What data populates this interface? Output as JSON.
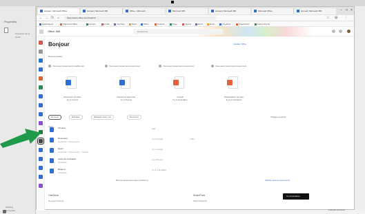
{
  "left_pane": {
    "title": "Properties",
    "sub_line1": "Propriétés de la",
    "sub_line2": "feuille",
    "bottom_line1": "Working",
    "bottom_line2": "connected"
  },
  "browser": {
    "tabs": [
      {
        "label": "Accueil - Microsoft Office"
      },
      {
        "label": "Accueil | Microsoft 365"
      },
      {
        "label": "Office - Microsoft"
      },
      {
        "label": "Microsoft 365"
      },
      {
        "label": "Accueil | Microsoft 365"
      },
      {
        "label": "Microsoft Office"
      },
      {
        "label": "Accueil | Microsoft 365"
      }
    ],
    "url": "https://www.office.com/?auth=2",
    "bookmarks": [
      "Applications",
      "Microsoft Office",
      "Accueil",
      "Gmail",
      "YouTube",
      "Maps",
      "Office",
      "Outlook",
      "Drive",
      "Teams",
      "Word",
      "Excel",
      "OneDrive",
      "PowerPoint",
      "Autres favoris"
    ]
  },
  "office_header": {
    "app_name": "Office 365",
    "search_placeholder": "Rechercher"
  },
  "rail": {
    "selected_label": "Word",
    "colors": [
      "#d9534f",
      "#999999",
      "#2f6fd1",
      "#2f6fd1",
      "#e0622d",
      "#2e8b57",
      "#2f6fd1",
      "#2f6fd1",
      "#2f6fd1",
      "#8a4fd1",
      "#1f7a3f",
      "#444444",
      "#2f6fd1",
      "#2f6fd1",
      "#2f6fd1",
      "#2f6fd1",
      "#8a4fd1"
    ]
  },
  "main": {
    "greeting": "Bonjour",
    "install_link": "Installer Office",
    "recommended_label": "Recommandés",
    "recent_headers": [
      "Vous avez récemment modifié ceci",
      "Vous avez récemment ouvert ceci",
      "Vous avez récemment ouvert ceci",
      "Vous avez récemment ouvert ceci"
    ],
    "cards": [
      {
        "caption1": "Document (1).docx",
        "caption2": "Il y a 3 jours",
        "color": "#2f6fd1"
      },
      {
        "caption1": "Document sans titre",
        "caption2": "Il y a 5 jours",
        "color": "#2f6fd1"
      },
      {
        "caption1": "CV.pdf",
        "caption2": "Il y a 1 semaine",
        "color": "#e0623b"
      },
      {
        "caption1": "Présentation (1).pptx",
        "caption2": "Il y a 2 semaines",
        "color": "#e0623b"
      }
    ],
    "filters": [
      "Récents",
      "Épinglés",
      "Partagés avec moi",
      "Découvrir"
    ],
    "filter_right": "Charger et ouvrir",
    "files": [
      {
        "name": "CV.docx",
        "path": "",
        "date": "Hier",
        "size": "",
        "color": "#2f6fd1"
      },
      {
        "name": "Document",
        "path": "OneDrive > Documents",
        "date": "Il y a 2 jours",
        "size": "1 Mo",
        "color": "#2f6fd1"
      },
      {
        "name": "Devis",
        "path": "OneDrive > Documents > Travail",
        "date": "Il y a 3 jours",
        "size": "",
        "color": "#2f6fd1"
      },
      {
        "name": "Lettre de motivation",
        "path": "OneDrive",
        "date": "Il y a 5 jours",
        "size": "",
        "color": "#2f6fd1"
      },
      {
        "name": "Rapport",
        "path": "OneDrive",
        "date": "Il y a 1 semaine",
        "size": "",
        "color": "#2f6fd1"
      }
    ],
    "more_files": "Plus de documents dans OneDrive",
    "more_right": "Afficher plus de documents",
    "bottom_left_title": "OneDrive",
    "bottom_left_sub": "Dossiers récents",
    "bottom_right_title": "SharePoint",
    "bottom_right_sub": "Sites fréquents",
    "dark_badge": "Commentaires"
  },
  "status_right": "Français (France)"
}
